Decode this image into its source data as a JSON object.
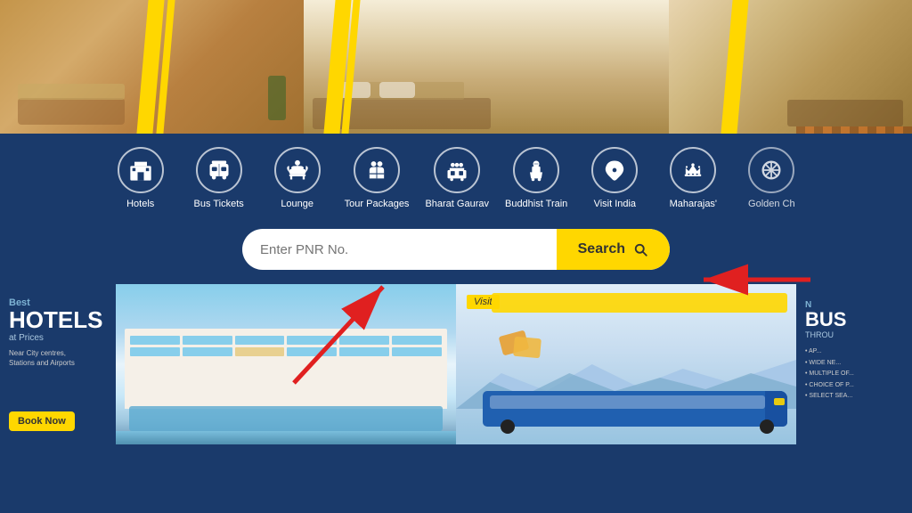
{
  "hero": {
    "alt": "Hotel room interior banner"
  },
  "nav": {
    "items": [
      {
        "id": "hotels",
        "label": "Hotels",
        "icon": "hotel"
      },
      {
        "id": "bus-tickets",
        "label": "Bus Tickets",
        "icon": "bus"
      },
      {
        "id": "lounge",
        "label": "Lounge",
        "icon": "lounge"
      },
      {
        "id": "tour-packages",
        "label": "Tour Packages",
        "icon": "tour"
      },
      {
        "id": "bharat-gaurav",
        "label": "Bharat Gaurav",
        "icon": "train-people"
      },
      {
        "id": "buddhist-train",
        "label": "Buddhist Train",
        "icon": "buddhist"
      },
      {
        "id": "visit-india",
        "label": "Visit India",
        "icon": "india"
      },
      {
        "id": "maharajas",
        "label": "Maharajas'",
        "icon": "maharaja"
      },
      {
        "id": "golden-ch",
        "label": "Golden Ch",
        "icon": "chariot"
      }
    ]
  },
  "search": {
    "placeholder": "Enter PNR No.",
    "button_label": "Search"
  },
  "banners": [
    {
      "id": "hotels-banner",
      "title": "Best\nHOTELS",
      "subtitle": "at Prices",
      "body": "Near City centres,\nStations and Airports",
      "cta": "Book Now"
    },
    {
      "id": "hotel-image-banner",
      "alt": "Hotel exterior with pool"
    },
    {
      "id": "visit-banner",
      "label": "Visit",
      "alt": "Bus travel illustration"
    },
    {
      "id": "bus-banner",
      "title": "BUS",
      "subtitle": "THROU",
      "list": [
        "• AP...",
        "• WIDE NE...",
        "• MULTIPLE OF P...",
        "• CHOICE OF P...",
        "• SELECT SEA..."
      ],
      "cta": ""
    }
  ],
  "colors": {
    "primary_blue": "#1a3a6b",
    "accent_yellow": "#FFD700",
    "white": "#ffffff",
    "light_blue": "#d0e8f8"
  }
}
